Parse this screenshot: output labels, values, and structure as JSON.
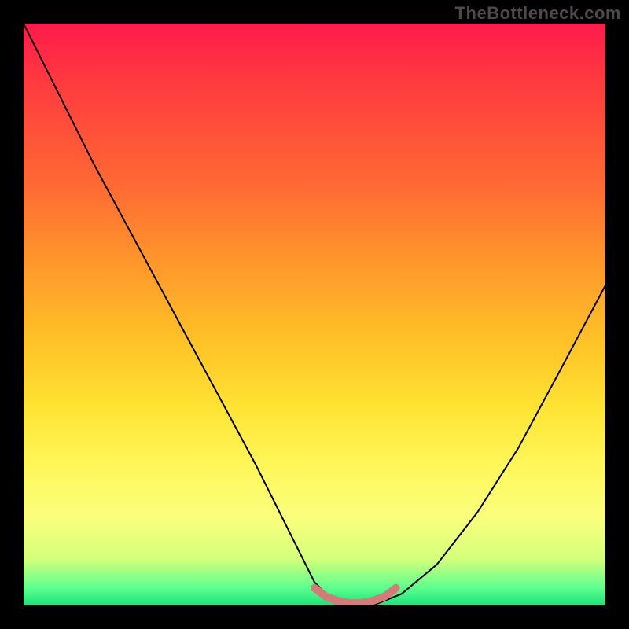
{
  "watermark": "TheBottleneck.com",
  "chart_data": {
    "type": "line",
    "title": "",
    "xlabel": "",
    "ylabel": "",
    "xlim": [
      0,
      100
    ],
    "ylim": [
      0,
      100
    ],
    "grid": false,
    "legend_position": "none",
    "background_gradient": {
      "direction": "vertical",
      "stops": [
        {
          "pct": 0,
          "color": "#ff1a4b"
        },
        {
          "pct": 10,
          "color": "#ff3a3f"
        },
        {
          "pct": 28,
          "color": "#ff6a33"
        },
        {
          "pct": 42,
          "color": "#ff9a2b"
        },
        {
          "pct": 55,
          "color": "#ffc327"
        },
        {
          "pct": 66,
          "color": "#ffe334"
        },
        {
          "pct": 76,
          "color": "#fff75a"
        },
        {
          "pct": 85,
          "color": "#f9ff7d"
        },
        {
          "pct": 92,
          "color": "#d4ff7a"
        },
        {
          "pct": 97,
          "color": "#5cff8e"
        },
        {
          "pct": 100,
          "color": "#19e37a"
        }
      ]
    },
    "series": [
      {
        "name": "bottleneck_curve",
        "color": "#000000",
        "stroke_width": 2,
        "x": [
          0,
          6,
          12,
          19,
          26,
          33,
          40,
          46,
          50,
          53,
          56,
          60,
          65,
          71,
          78,
          85,
          92,
          100
        ],
        "y": [
          100,
          88,
          76,
          63,
          50,
          37,
          24,
          12,
          4,
          1,
          0,
          0,
          2,
          7,
          16,
          27,
          40,
          55
        ]
      },
      {
        "name": "optimum_band",
        "color": "#d47a78",
        "stroke_width": 10,
        "x": [
          50,
          52,
          54,
          56,
          58,
          60,
          62,
          64
        ],
        "y": [
          3,
          1.5,
          0.8,
          0.4,
          0.4,
          0.8,
          1.5,
          3
        ]
      }
    ]
  }
}
